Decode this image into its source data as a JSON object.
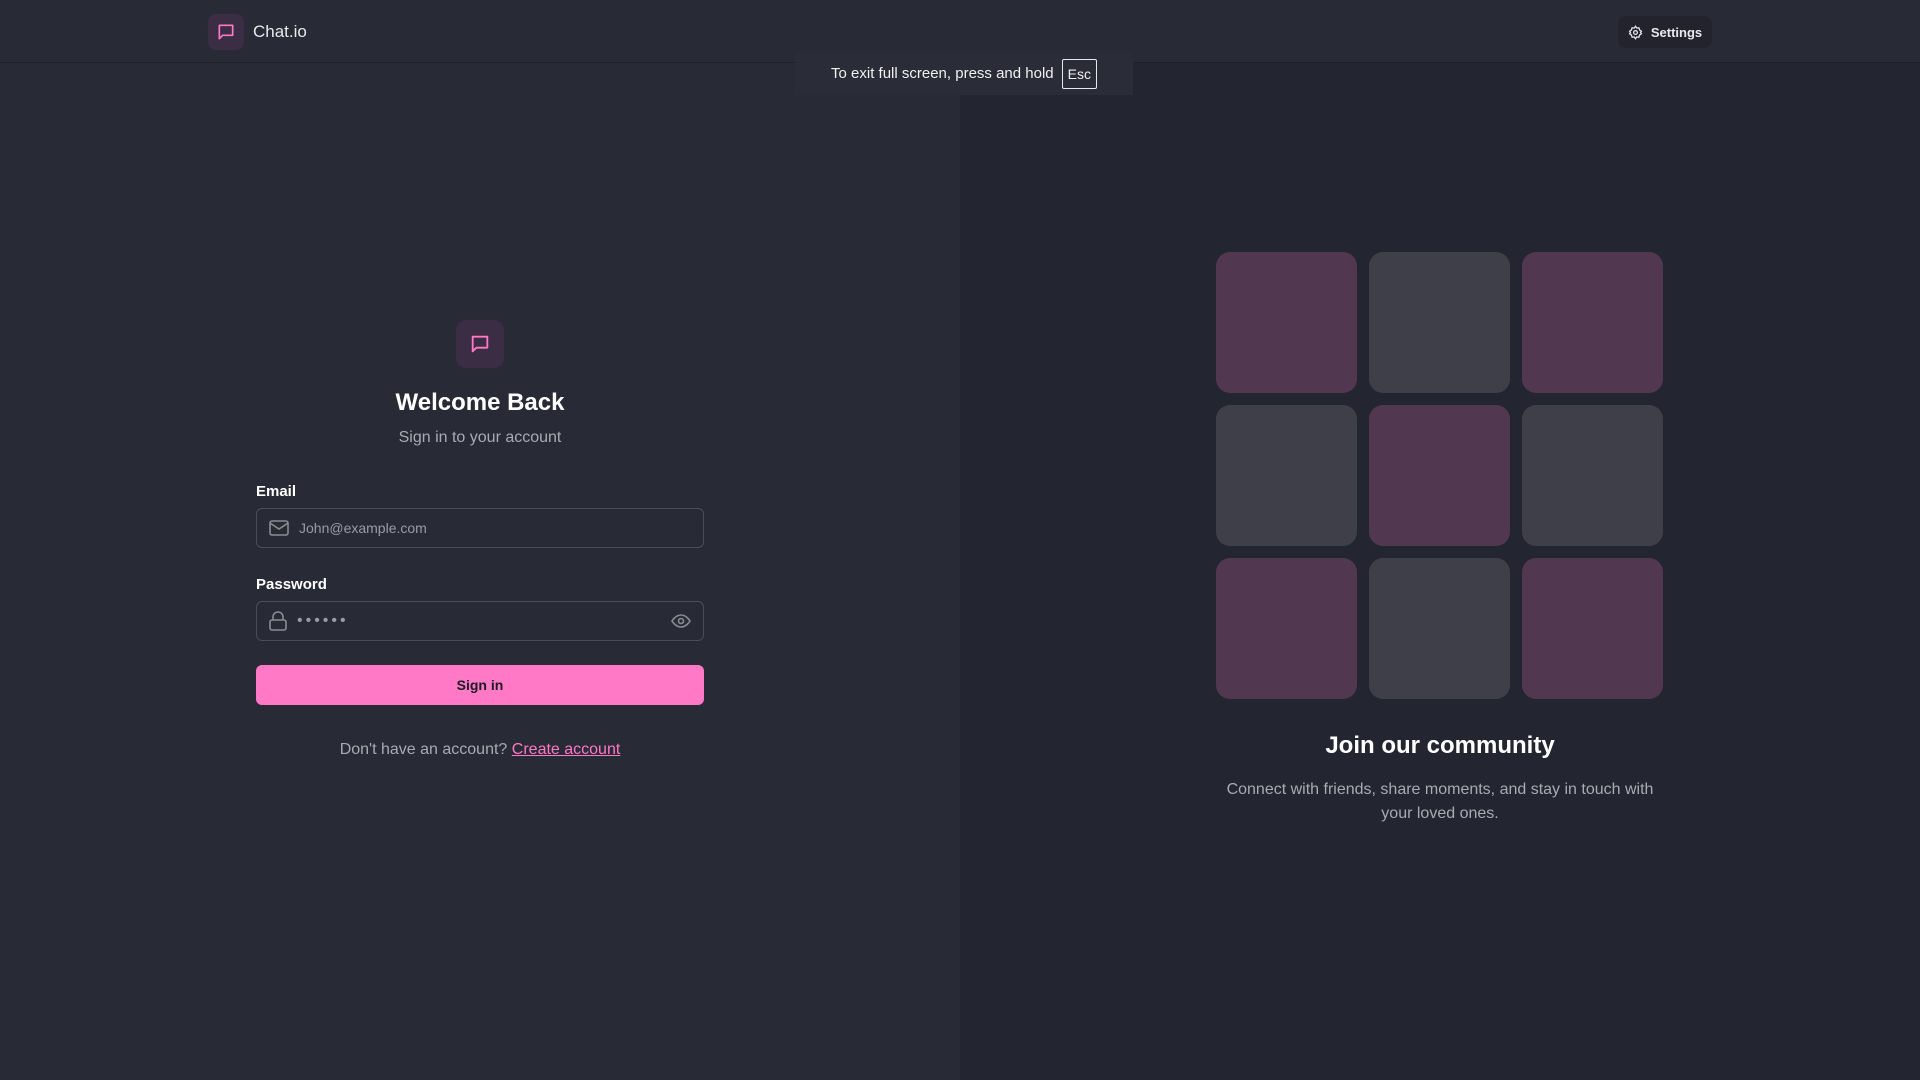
{
  "header": {
    "brand": "Chat.io",
    "settings_label": "Settings"
  },
  "fullscreen_toast": {
    "text": "To exit full screen, press and hold",
    "key": "Esc"
  },
  "login": {
    "title": "Welcome Back",
    "subtitle": "Sign in to your account",
    "email_label": "Email",
    "email_placeholder": "John@example.com",
    "password_label": "Password",
    "password_value": "••••••",
    "submit_label": "Sign in",
    "no_account_text": "Don't have an account?",
    "create_account_link": "Create account"
  },
  "community": {
    "tiles": [
      "pink",
      "gray",
      "pink",
      "gray",
      "pink",
      "gray",
      "pink",
      "gray",
      "pink"
    ],
    "title": "Join our community",
    "description": "Connect with friends, share moments, and stay in touch with your loved ones."
  },
  "colors": {
    "accent": "#ff79c6",
    "background": "#282a36",
    "panel": "#232530",
    "tile_pink": "#513750",
    "tile_gray": "#3e3f49"
  }
}
